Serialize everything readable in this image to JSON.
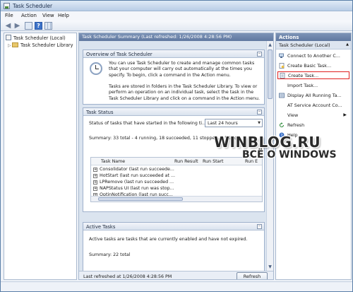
{
  "window": {
    "title": "Task Scheduler"
  },
  "menu": [
    "File",
    "Action",
    "View",
    "Help"
  ],
  "toolbar": {
    "icons": [
      "back-arrow-icon",
      "forward-arrow-icon",
      "show-hide-tree-icon",
      "help-icon",
      "show-hide-action-pane-icon"
    ],
    "help_glyph": "?"
  },
  "tree": {
    "items": [
      {
        "label": "Task Scheduler (Local)",
        "icon": "task-scheduler-icon"
      },
      {
        "label": "Task Scheduler Library",
        "icon": "folder-icon"
      }
    ]
  },
  "center": {
    "header": "Task Scheduler Summary (Last refreshed: 1/26/2008 4:28:56 PM)",
    "overview": {
      "title": "Overview of Task Scheduler",
      "para1_lines": [
        "You can use Task Scheduler to create and manage common tasks",
        "that your computer will carry out automatically at the times you",
        "specify. To begin, click a command in the Action menu."
      ],
      "para2_lines": [
        "Tasks are stored in folders in the Task Scheduler Library. To view or",
        "perform an operation on an individual task, select the task in the",
        "Task Scheduler Library and click on a command in the Action menu."
      ]
    },
    "task_status": {
      "title": "Task Status",
      "filter_label": "Status of tasks that have started in the following ti...",
      "filter_value": "Last 24 hours",
      "summary": "Summary: 33 total - 4 running, 18 succeeded, 11 stopped, 0 failed",
      "columns": [
        "Task Name",
        "Run Result",
        "Run Start",
        "Run E"
      ],
      "rows": [
        "Consolidator (last run succeede...",
        "HotStart (last run succeeded at ...",
        "LPRemove (last run succeeded ...",
        "NAPStatus UI (last run was stop...",
        "OptinNotification (last run succ..."
      ]
    },
    "active_tasks": {
      "title": "Active Tasks",
      "description": "Active tasks are tasks that are currently enabled and have not expired.",
      "summary": "Summary: 22 total"
    },
    "footer": {
      "last_refreshed": "Last refreshed at 1/26/2008 4:28:56 PM",
      "refresh_button": "Refresh"
    }
  },
  "actions": {
    "title": "Actions",
    "subheader": "Task Scheduler (Local)",
    "items": [
      {
        "label": "Connect to Another C...",
        "icon": "connect-icon"
      },
      {
        "label": "Create Basic Task...",
        "icon": "create-basic-task-icon"
      },
      {
        "label": "Create Task...",
        "icon": "create-task-icon",
        "highlighted": true
      },
      {
        "label": "Import Task...",
        "icon": "none"
      },
      {
        "label": "Display All Running Ta...",
        "icon": "display-running-icon"
      },
      {
        "label": "AT Service Account Co...",
        "icon": "none"
      },
      {
        "label": "View",
        "icon": "none",
        "submenu": true
      },
      {
        "label": "Refresh",
        "icon": "refresh-icon"
      },
      {
        "label": "Help",
        "icon": "help-icon"
      }
    ]
  },
  "watermark": {
    "line1": "WINBLOG.RU",
    "line2": "ВСЁ О WINDOWS"
  },
  "colors": {
    "header_blue": "#6078a0",
    "highlight_red": "#e02020",
    "panel_bg": "#dbe4ef"
  }
}
